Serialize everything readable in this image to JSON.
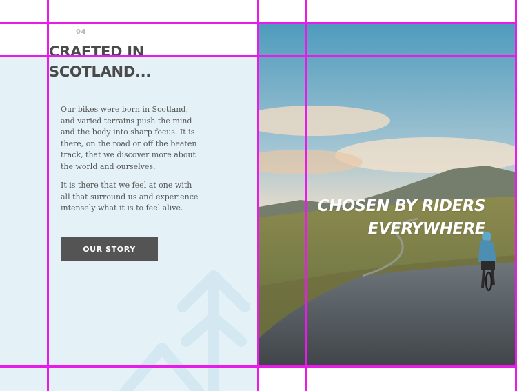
{
  "section": {
    "number": "04",
    "heading_line1": "CRAFTED IN",
    "heading_line2": "SCOTLAND...",
    "paragraph1": "Our bikes were born in Scotland, and varied terrains push the mind and the body into sharp focus. It is there, on the road or off the beaten track, that we discover more about the world and ourselves.",
    "paragraph2": "It is there that we feel at one with all that surround us and experience intensely what it is to feel alive.",
    "button_label": "OUR STORY"
  },
  "hero": {
    "tagline_line1": "CHOSEN BY RIDERS",
    "tagline_line2": "EVERYWHERE"
  },
  "colors": {
    "panel_background": "#e4f2f8",
    "button_background": "#545454",
    "heading_text": "#4a4a4a",
    "guide_line": "#e81be8"
  }
}
